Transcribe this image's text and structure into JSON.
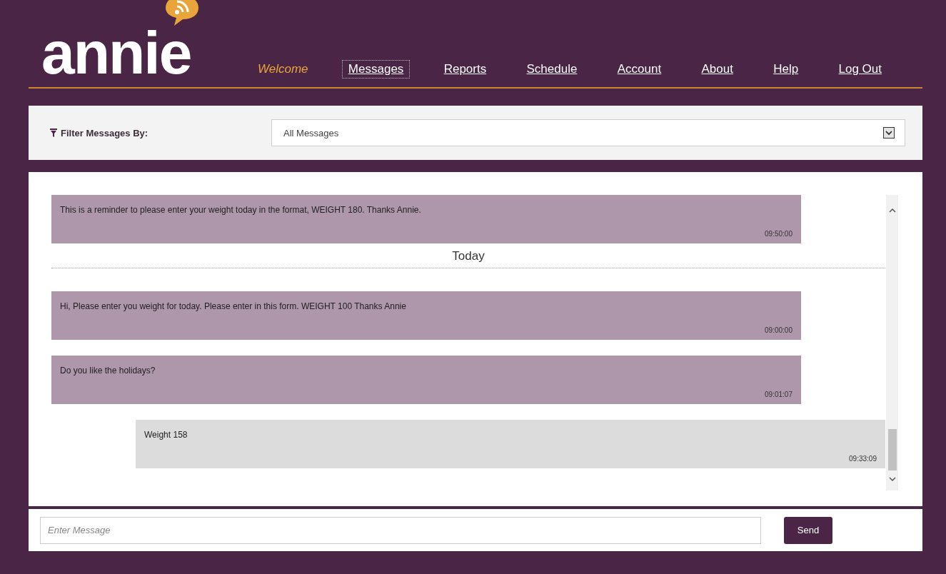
{
  "logo": {
    "text": "annie"
  },
  "nav": [
    {
      "label": "Welcome",
      "kind": "greeting",
      "selected": false
    },
    {
      "label": "Messages",
      "kind": "link",
      "selected": true
    },
    {
      "label": "Reports",
      "kind": "link",
      "selected": false
    },
    {
      "label": "Schedule",
      "kind": "link",
      "selected": false
    },
    {
      "label": "Account",
      "kind": "link",
      "selected": false
    },
    {
      "label": "About",
      "kind": "link",
      "selected": false
    },
    {
      "label": "Help",
      "kind": "link",
      "selected": false
    },
    {
      "label": "Log Out",
      "kind": "link",
      "selected": false
    }
  ],
  "filter": {
    "label": "Filter Messages By:",
    "value": "All Messages"
  },
  "messages": [
    {
      "kind": "incoming",
      "text": "This is a reminder to please enter your weight today in the format, WEIGHT 180. Thanks Annie.",
      "time": "09:50:00"
    },
    {
      "kind": "date",
      "text": "Today"
    },
    {
      "kind": "incoming",
      "text": "Hi, Please enter you weight for today. Please enter in this form. WEIGHT 100 Thanks Annie",
      "time": "09:00:00"
    },
    {
      "kind": "incoming",
      "text": "Do you like the holidays?",
      "time": "09:01:07"
    },
    {
      "kind": "outgoing",
      "text": "Weight 158",
      "time": "09:33:09"
    }
  ],
  "composer": {
    "placeholder": "Enter Message",
    "button": "Send"
  }
}
